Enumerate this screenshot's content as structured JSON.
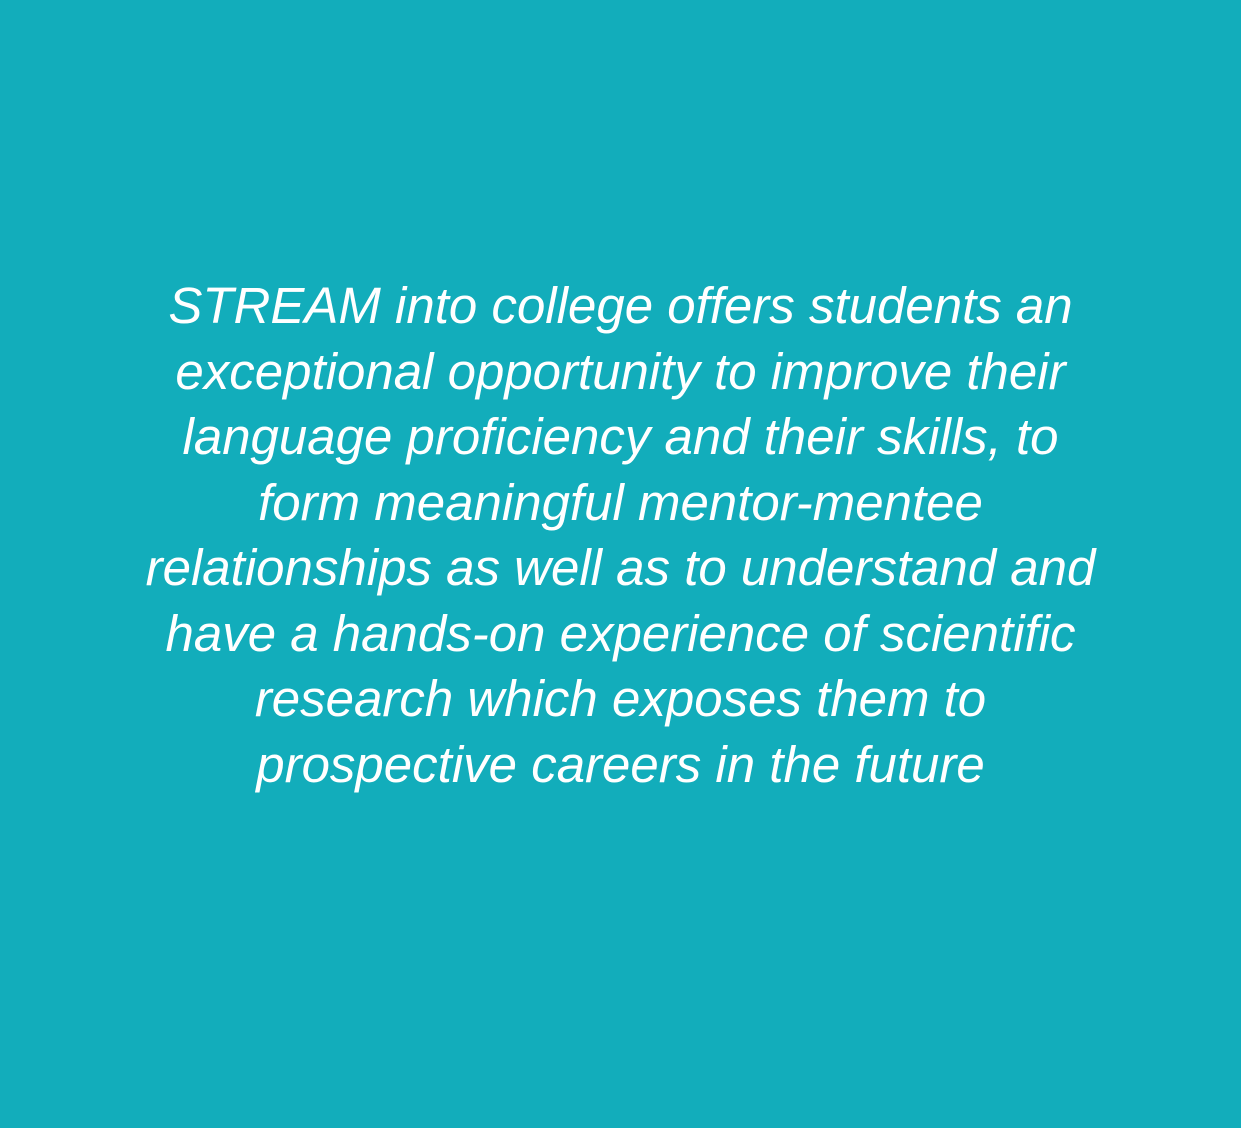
{
  "colors": {
    "background": "#12adbb",
    "text": "#ffffff"
  },
  "quote": {
    "lines": [
      "STREAM into college offers students an",
      "exceptional opportunity to improve their",
      "language proficiency and their skills, to",
      "form meaningful mentor-mentee",
      "relationships as well as to understand and",
      "have a hands-on experience of scientific",
      "research which exposes them to",
      "prospective careers in the future"
    ]
  }
}
